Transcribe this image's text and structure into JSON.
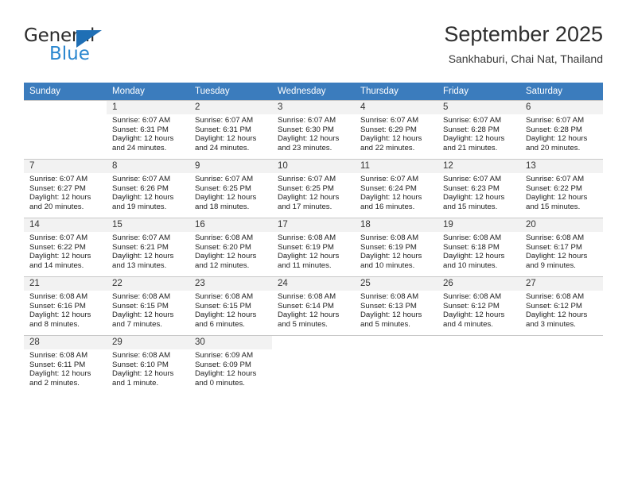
{
  "brand": {
    "name_top": "General",
    "name_bottom": "Blue",
    "triangle_color": "#1f6fb5",
    "blue_color": "#2b87cf"
  },
  "header": {
    "title": "September 2025",
    "subtitle": "Sankhaburi, Chai Nat, Thailand"
  },
  "theme": {
    "header_row_bg": "#3b7cbd",
    "header_row_text": "#ffffff",
    "daynum_bg": "#f2f2f2",
    "grid_line": "#c8c8c8"
  },
  "weekdays": [
    "Sunday",
    "Monday",
    "Tuesday",
    "Wednesday",
    "Thursday",
    "Friday",
    "Saturday"
  ],
  "weeks": [
    [
      {
        "day": "",
        "lines": []
      },
      {
        "day": "1",
        "lines": [
          "Sunrise: 6:07 AM",
          "Sunset: 6:31 PM",
          "Daylight: 12 hours",
          "and 24 minutes."
        ]
      },
      {
        "day": "2",
        "lines": [
          "Sunrise: 6:07 AM",
          "Sunset: 6:31 PM",
          "Daylight: 12 hours",
          "and 24 minutes."
        ]
      },
      {
        "day": "3",
        "lines": [
          "Sunrise: 6:07 AM",
          "Sunset: 6:30 PM",
          "Daylight: 12 hours",
          "and 23 minutes."
        ]
      },
      {
        "day": "4",
        "lines": [
          "Sunrise: 6:07 AM",
          "Sunset: 6:29 PM",
          "Daylight: 12 hours",
          "and 22 minutes."
        ]
      },
      {
        "day": "5",
        "lines": [
          "Sunrise: 6:07 AM",
          "Sunset: 6:28 PM",
          "Daylight: 12 hours",
          "and 21 minutes."
        ]
      },
      {
        "day": "6",
        "lines": [
          "Sunrise: 6:07 AM",
          "Sunset: 6:28 PM",
          "Daylight: 12 hours",
          "and 20 minutes."
        ]
      }
    ],
    [
      {
        "day": "7",
        "lines": [
          "Sunrise: 6:07 AM",
          "Sunset: 6:27 PM",
          "Daylight: 12 hours",
          "and 20 minutes."
        ]
      },
      {
        "day": "8",
        "lines": [
          "Sunrise: 6:07 AM",
          "Sunset: 6:26 PM",
          "Daylight: 12 hours",
          "and 19 minutes."
        ]
      },
      {
        "day": "9",
        "lines": [
          "Sunrise: 6:07 AM",
          "Sunset: 6:25 PM",
          "Daylight: 12 hours",
          "and 18 minutes."
        ]
      },
      {
        "day": "10",
        "lines": [
          "Sunrise: 6:07 AM",
          "Sunset: 6:25 PM",
          "Daylight: 12 hours",
          "and 17 minutes."
        ]
      },
      {
        "day": "11",
        "lines": [
          "Sunrise: 6:07 AM",
          "Sunset: 6:24 PM",
          "Daylight: 12 hours",
          "and 16 minutes."
        ]
      },
      {
        "day": "12",
        "lines": [
          "Sunrise: 6:07 AM",
          "Sunset: 6:23 PM",
          "Daylight: 12 hours",
          "and 15 minutes."
        ]
      },
      {
        "day": "13",
        "lines": [
          "Sunrise: 6:07 AM",
          "Sunset: 6:22 PM",
          "Daylight: 12 hours",
          "and 15 minutes."
        ]
      }
    ],
    [
      {
        "day": "14",
        "lines": [
          "Sunrise: 6:07 AM",
          "Sunset: 6:22 PM",
          "Daylight: 12 hours",
          "and 14 minutes."
        ]
      },
      {
        "day": "15",
        "lines": [
          "Sunrise: 6:07 AM",
          "Sunset: 6:21 PM",
          "Daylight: 12 hours",
          "and 13 minutes."
        ]
      },
      {
        "day": "16",
        "lines": [
          "Sunrise: 6:08 AM",
          "Sunset: 6:20 PM",
          "Daylight: 12 hours",
          "and 12 minutes."
        ]
      },
      {
        "day": "17",
        "lines": [
          "Sunrise: 6:08 AM",
          "Sunset: 6:19 PM",
          "Daylight: 12 hours",
          "and 11 minutes."
        ]
      },
      {
        "day": "18",
        "lines": [
          "Sunrise: 6:08 AM",
          "Sunset: 6:19 PM",
          "Daylight: 12 hours",
          "and 10 minutes."
        ]
      },
      {
        "day": "19",
        "lines": [
          "Sunrise: 6:08 AM",
          "Sunset: 6:18 PM",
          "Daylight: 12 hours",
          "and 10 minutes."
        ]
      },
      {
        "day": "20",
        "lines": [
          "Sunrise: 6:08 AM",
          "Sunset: 6:17 PM",
          "Daylight: 12 hours",
          "and 9 minutes."
        ]
      }
    ],
    [
      {
        "day": "21",
        "lines": [
          "Sunrise: 6:08 AM",
          "Sunset: 6:16 PM",
          "Daylight: 12 hours",
          "and 8 minutes."
        ]
      },
      {
        "day": "22",
        "lines": [
          "Sunrise: 6:08 AM",
          "Sunset: 6:15 PM",
          "Daylight: 12 hours",
          "and 7 minutes."
        ]
      },
      {
        "day": "23",
        "lines": [
          "Sunrise: 6:08 AM",
          "Sunset: 6:15 PM",
          "Daylight: 12 hours",
          "and 6 minutes."
        ]
      },
      {
        "day": "24",
        "lines": [
          "Sunrise: 6:08 AM",
          "Sunset: 6:14 PM",
          "Daylight: 12 hours",
          "and 5 minutes."
        ]
      },
      {
        "day": "25",
        "lines": [
          "Sunrise: 6:08 AM",
          "Sunset: 6:13 PM",
          "Daylight: 12 hours",
          "and 5 minutes."
        ]
      },
      {
        "day": "26",
        "lines": [
          "Sunrise: 6:08 AM",
          "Sunset: 6:12 PM",
          "Daylight: 12 hours",
          "and 4 minutes."
        ]
      },
      {
        "day": "27",
        "lines": [
          "Sunrise: 6:08 AM",
          "Sunset: 6:12 PM",
          "Daylight: 12 hours",
          "and 3 minutes."
        ]
      }
    ],
    [
      {
        "day": "28",
        "lines": [
          "Sunrise: 6:08 AM",
          "Sunset: 6:11 PM",
          "Daylight: 12 hours",
          "and 2 minutes."
        ]
      },
      {
        "day": "29",
        "lines": [
          "Sunrise: 6:08 AM",
          "Sunset: 6:10 PM",
          "Daylight: 12 hours",
          "and 1 minute."
        ]
      },
      {
        "day": "30",
        "lines": [
          "Sunrise: 6:09 AM",
          "Sunset: 6:09 PM",
          "Daylight: 12 hours",
          "and 0 minutes."
        ]
      },
      {
        "day": "",
        "lines": []
      },
      {
        "day": "",
        "lines": []
      },
      {
        "day": "",
        "lines": []
      },
      {
        "day": "",
        "lines": []
      }
    ]
  ]
}
